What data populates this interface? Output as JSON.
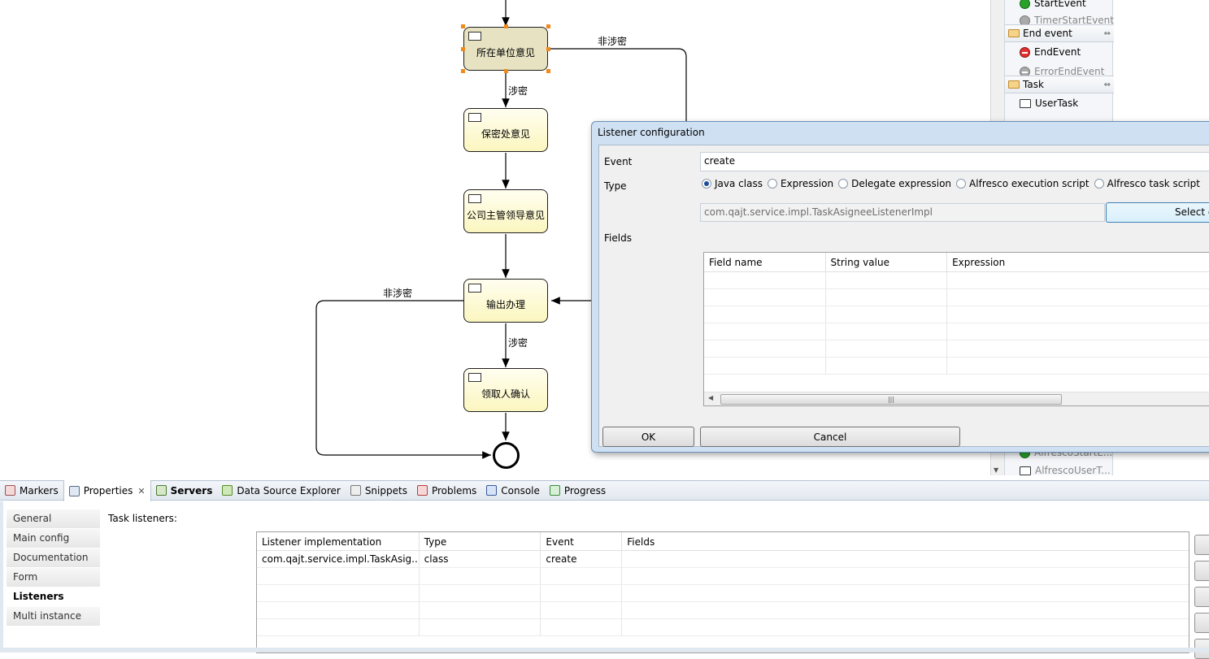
{
  "diagram": {
    "tasks": [
      {
        "name": "所在单位意见",
        "selected": true
      },
      {
        "name": "保密处意见"
      },
      {
        "name": "公司主管领导意见"
      },
      {
        "name": "输出办理"
      },
      {
        "name": "领取人确认"
      }
    ],
    "flow_labels": {
      "fei_shemi_top": "非涉密",
      "shemi_1": "涉密",
      "fei_shemi_left": "非涉密",
      "shemi_2": "涉密"
    }
  },
  "palette": {
    "items": {
      "start_event": "StartEvent",
      "timer_start_event": "TimerStartEvent",
      "end_event_group": "End event",
      "end_event": "EndEvent",
      "error_end_event": "ErrorEndEvent",
      "task_group": "Task",
      "user_task": "UserTask",
      "alfresco_start": "AlfrescoStartE...",
      "alfresco_user": "AlfrescoUserT..."
    }
  },
  "dialog": {
    "title": "Listener configuration",
    "event_label": "Event",
    "event_value": "create",
    "type_label": "Type",
    "types": [
      "Java class",
      "Expression",
      "Delegate expression",
      "Alfresco execution script",
      "Alfresco task script"
    ],
    "selected_type": "Java class",
    "class_value": "com.qajt.service.impl.TaskAsigneeListenerImpl",
    "select_button": "Select class",
    "fields_label": "Fields",
    "fields_columns": [
      "Field name",
      "String value",
      "Expression"
    ],
    "ok": "OK",
    "cancel": "Cancel"
  },
  "views": {
    "tabs": [
      "Markers",
      "Properties",
      "Servers",
      "Data Source Explorer",
      "Snippets",
      "Problems",
      "Console",
      "Progress"
    ],
    "active_tab": "Properties"
  },
  "properties": {
    "nav": [
      "General",
      "Main config",
      "Documentation",
      "Form",
      "Listeners",
      "Multi instance"
    ],
    "active_nav": "Listeners",
    "task_listeners_label": "Task listeners:",
    "columns": [
      "Listener implementation",
      "Type",
      "Event",
      "Fields"
    ],
    "rows": [
      {
        "impl": "com.qajt.service.impl.TaskAsig...",
        "type": "class",
        "event": "create",
        "fields": ""
      }
    ]
  }
}
